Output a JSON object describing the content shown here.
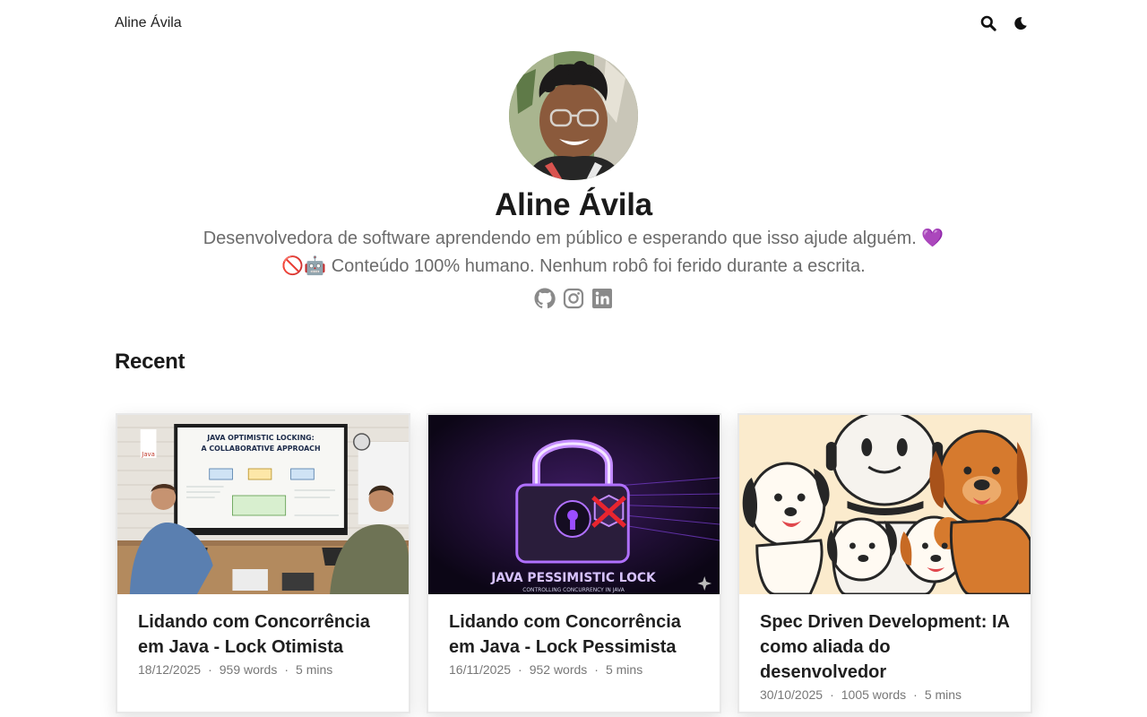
{
  "header": {
    "site_title": "Aline Ávila"
  },
  "profile": {
    "name": "Aline Ávila",
    "bio_line1": "Desenvolvedora de software aprendendo em público e esperando que isso ajude alguém. 💜",
    "bio_line2": "🚫🤖 Conteúdo 100% humano. Nenhum robô foi ferido durante a escrita."
  },
  "section": {
    "recent_title": "Recent"
  },
  "posts": [
    {
      "title": "Lidando com Concorrência em Java - Lock Otimista",
      "date": "18/12/2025",
      "words": "959 words",
      "reading": "5 mins",
      "thumb_heading": "JAVA OPTIMISTIC LOCKING:",
      "thumb_subheading": "A COLLABORATIVE APPROACH"
    },
    {
      "title": "Lidando com Concorrência em Java - Lock Pessimista",
      "date": "16/11/2025",
      "words": "952 words",
      "reading": "5 mins",
      "thumb_heading": "JAVA PESSIMISTIC LOCK",
      "thumb_subheading": "CONTROLLING CONCURRENCY IN JAVA"
    },
    {
      "title": "Spec Driven Development: IA como aliada do desenvolvedor",
      "date": "30/10/2025",
      "words": "1005 words",
      "reading": "5 mins"
    }
  ],
  "meta_separator": "·",
  "icons": [
    "search-icon",
    "moon-icon",
    "github-icon",
    "instagram-icon",
    "linkedin-icon"
  ],
  "colors": {
    "text": "#1f1f1f",
    "muted": "#6b6b6b",
    "social": "#8a8a8a",
    "lock_purple": "#9b4dff"
  }
}
